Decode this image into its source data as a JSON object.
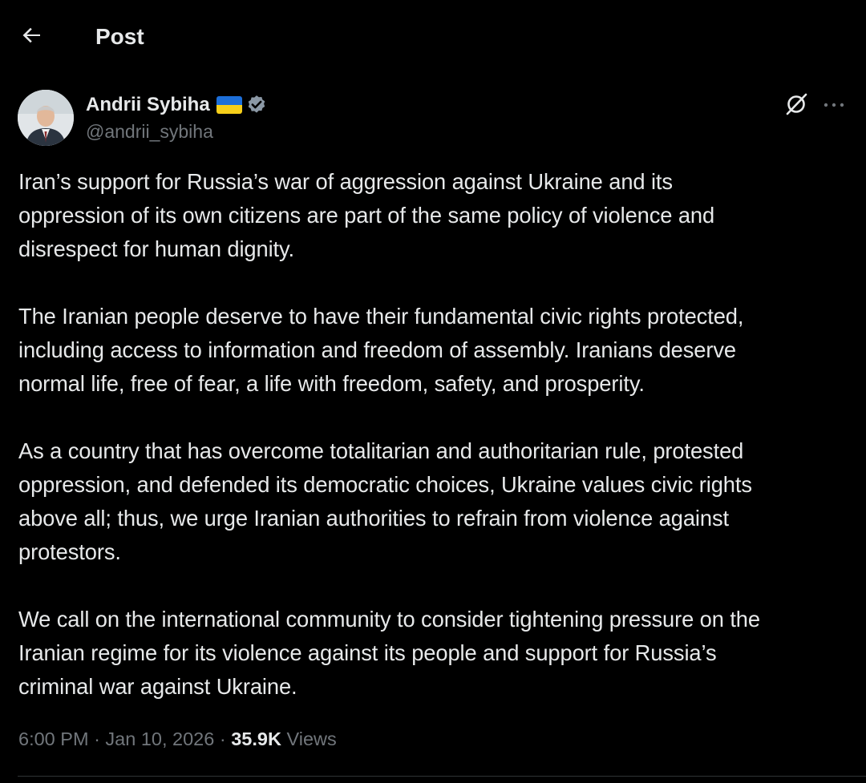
{
  "topbar": {
    "title": "Post",
    "back_icon": "arrow-left-icon"
  },
  "author": {
    "display_name": "Andrii Sybiha",
    "handle": "@andrii_sybiha",
    "flag_icon": "ukraine-flag-icon",
    "verified_icon": "verified-badge-icon",
    "verified_color": "#8b98a5"
  },
  "actions": {
    "grok_icon": "grok-icon",
    "more_icon": "more-horizontal-icon"
  },
  "post": {
    "paragraphs": [
      "Iran’s support for Russia’s war of aggression against Ukraine and its\noppression of its own citizens are part of the same policy of violence and\ndisrespect for human dignity.",
      "The Iranian people deserve to have their fundamental civic rights protected,\nincluding access to information and freedom of assembly. Iranians deserve\nnormal life, free of fear, a life with freedom, safety, and prosperity.",
      "As a country that has overcome totalitarian and authoritarian rule, protested\noppression, and defended its democratic choices, Ukraine values civic rights\nabove all; thus, we urge Iranian authorities to refrain from violence against\nprotestors.",
      "We call on the international community to consider tightening pressure on the\nIranian regime for its violence against its people and support for Russia’s\ncriminal war against Ukraine."
    ]
  },
  "meta": {
    "time": "6:00 PM",
    "separator": "·",
    "date": "Jan 10, 2026",
    "views_count": "35.9K",
    "views_label": "Views"
  },
  "colors": {
    "background": "#000000",
    "text": "#e7e9ea",
    "secondary_text": "#71767b",
    "divider": "#2f3336",
    "flag_blue": "#1d6fd9",
    "flag_yellow": "#f6cf1a"
  }
}
